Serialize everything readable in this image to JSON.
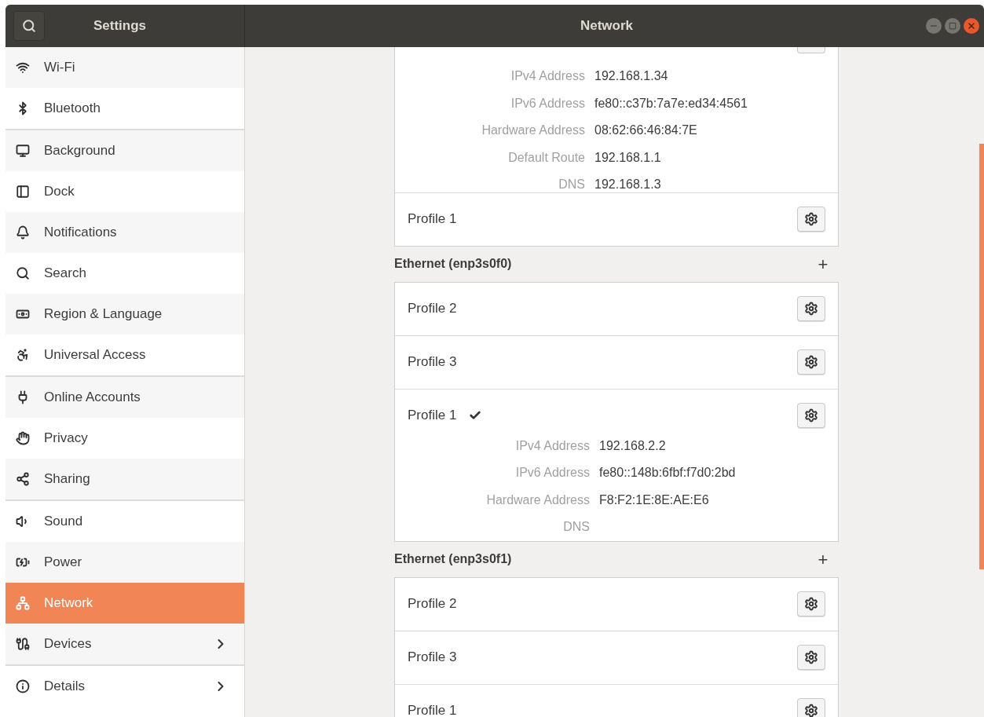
{
  "window": {
    "sidebar_title": "Settings",
    "title": "Network"
  },
  "sidebar": {
    "groups": [
      {
        "items": [
          {
            "label": "Wi-Fi",
            "selected": false,
            "has_submenu": false
          },
          {
            "label": "Bluetooth",
            "selected": false,
            "has_submenu": false
          }
        ]
      },
      {
        "items": [
          {
            "label": "Background",
            "selected": false,
            "has_submenu": false
          },
          {
            "label": "Dock",
            "selected": false,
            "has_submenu": false
          },
          {
            "label": "Notifications",
            "selected": false,
            "has_submenu": false
          },
          {
            "label": "Search",
            "selected": false,
            "has_submenu": false
          },
          {
            "label": "Region & Language",
            "selected": false,
            "has_submenu": false
          },
          {
            "label": "Universal Access",
            "selected": false,
            "has_submenu": false
          }
        ]
      },
      {
        "items": [
          {
            "label": "Online Accounts",
            "selected": false,
            "has_submenu": false
          },
          {
            "label": "Privacy",
            "selected": false,
            "has_submenu": false
          },
          {
            "label": "Sharing",
            "selected": false,
            "has_submenu": false
          }
        ]
      },
      {
        "items": [
          {
            "label": "Sound",
            "selected": false,
            "has_submenu": false
          },
          {
            "label": "Power",
            "selected": false,
            "has_submenu": false
          },
          {
            "label": "Network",
            "selected": true,
            "has_submenu": false
          },
          {
            "label": "Devices",
            "selected": false,
            "has_submenu": true
          }
        ]
      },
      {
        "items": [
          {
            "label": "Details",
            "selected": false,
            "has_submenu": true
          }
        ]
      }
    ]
  },
  "content": {
    "sections": [
      {
        "items": [
          {
            "kind": "details",
            "rows": [
              {
                "label": "IPv4 Address",
                "value": "192.168.1.34"
              },
              {
                "label": "IPv6 Address",
                "value": "fe80::c37b:7a7e:ed34:4561"
              },
              {
                "label": "Hardware Address",
                "value": "08:62:66:46:84:7E"
              },
              {
                "label": "Default Route",
                "value": "192.168.1.1"
              },
              {
                "label": "DNS",
                "value": "192.168.1.3"
              }
            ]
          },
          {
            "kind": "profile",
            "name": "Profile 1",
            "active": false
          }
        ]
      },
      {
        "header": {
          "label": "Ethernet (enp3s0f0)",
          "add_button": "+"
        },
        "items": [
          {
            "kind": "profile",
            "name": "Profile 2",
            "active": false
          },
          {
            "kind": "profile",
            "name": "Profile 3",
            "active": false
          },
          {
            "kind": "profile",
            "name": "Profile 1",
            "active": true,
            "details": [
              {
                "label": "IPv4 Address",
                "value": "192.168.2.2"
              },
              {
                "label": "IPv6 Address",
                "value": "fe80::148b:6fbf:f7d0:2bd"
              },
              {
                "label": "Hardware Address",
                "value": "F8:F2:1E:8E:AE:E6"
              },
              {
                "label": "DNS"
              }
            ]
          }
        ]
      },
      {
        "header": {
          "label": "Ethernet (enp3s0f1)",
          "add_button": "+"
        },
        "items": [
          {
            "kind": "profile",
            "name": "Profile 2",
            "active": false
          },
          {
            "kind": "profile",
            "name": "Profile 3",
            "active": false
          },
          {
            "kind": "profile",
            "name": "Profile 1",
            "active": false
          }
        ]
      }
    ]
  }
}
